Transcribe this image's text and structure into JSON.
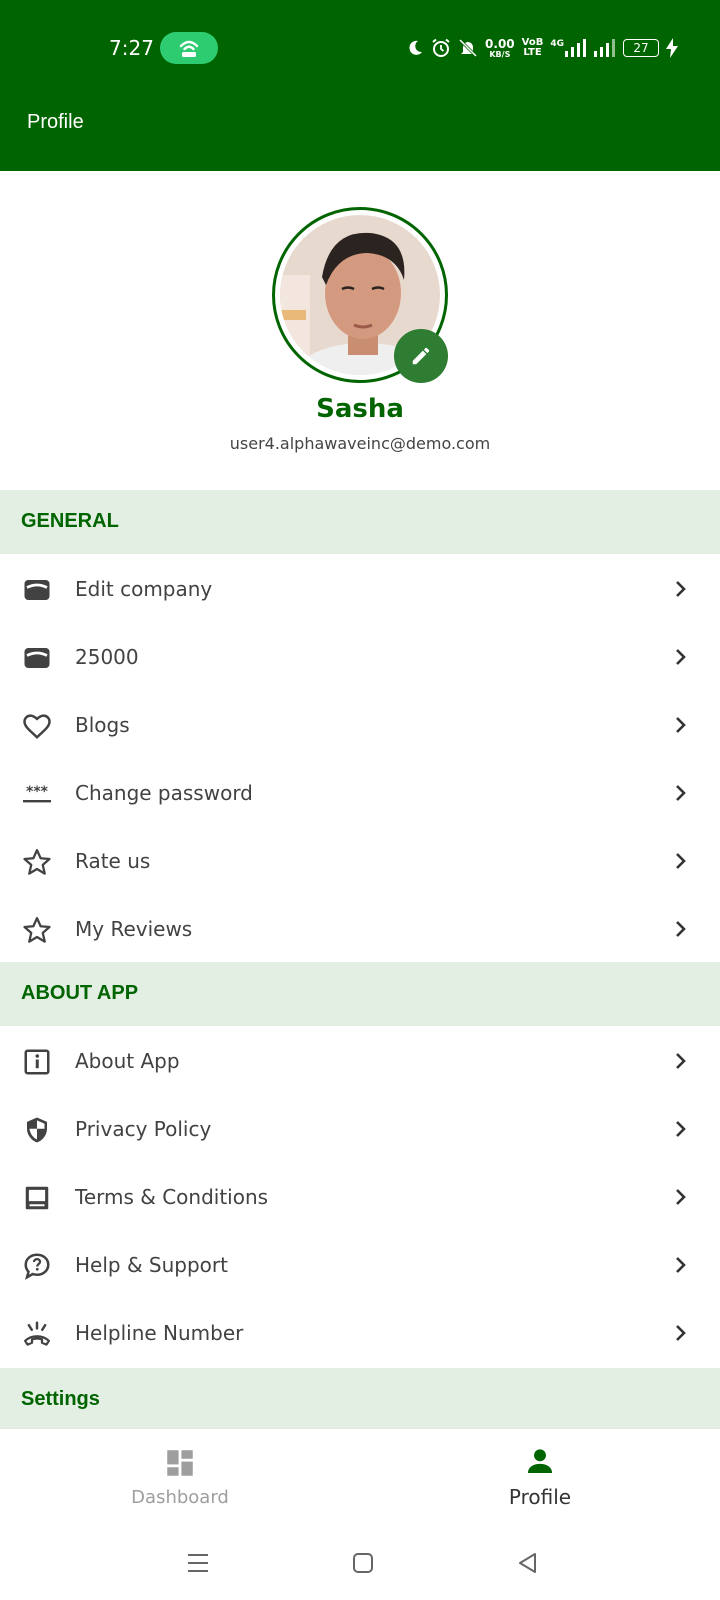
{
  "status_bar": {
    "time": "7:27",
    "data_rate_value": "0.00",
    "data_rate_unit": "KB/S",
    "volte_top": "VoB",
    "volte_bottom": "LTE",
    "network": "4G",
    "battery": "27"
  },
  "header": {
    "title": "Profile"
  },
  "profile": {
    "name": "Sasha",
    "email": "user4.alphawaveinc@demo.com"
  },
  "sections": {
    "general": {
      "title": "GENERAL",
      "items": [
        {
          "label": "Edit company",
          "icon": "wallet-icon"
        },
        {
          "label": "25000",
          "icon": "wallet-icon"
        },
        {
          "label": "Blogs",
          "icon": "heart-icon"
        },
        {
          "label": "Change password",
          "icon": "password-icon"
        },
        {
          "label": "Rate us",
          "icon": "star-icon"
        },
        {
          "label": "My Reviews",
          "icon": "star-icon"
        }
      ]
    },
    "about": {
      "title": "ABOUT APP",
      "items": [
        {
          "label": "About App",
          "icon": "info-icon"
        },
        {
          "label": "Privacy Policy",
          "icon": "shield-icon"
        },
        {
          "label": "Terms & Conditions",
          "icon": "document-icon"
        },
        {
          "label": "Help & Support",
          "icon": "help-icon"
        },
        {
          "label": "Helpline Number",
          "icon": "phone-ringing-icon"
        }
      ]
    },
    "settings": {
      "title": "Settings"
    }
  },
  "bottom_nav": {
    "items": [
      {
        "label": "Dashboard",
        "icon": "dashboard-icon",
        "active": false
      },
      {
        "label": "Profile",
        "icon": "person-icon",
        "active": true
      }
    ]
  },
  "colors": {
    "primary": "#006400",
    "section_bg": "#e3efe3",
    "fab": "#2e7d32",
    "hotspot": "#2ecc71"
  }
}
